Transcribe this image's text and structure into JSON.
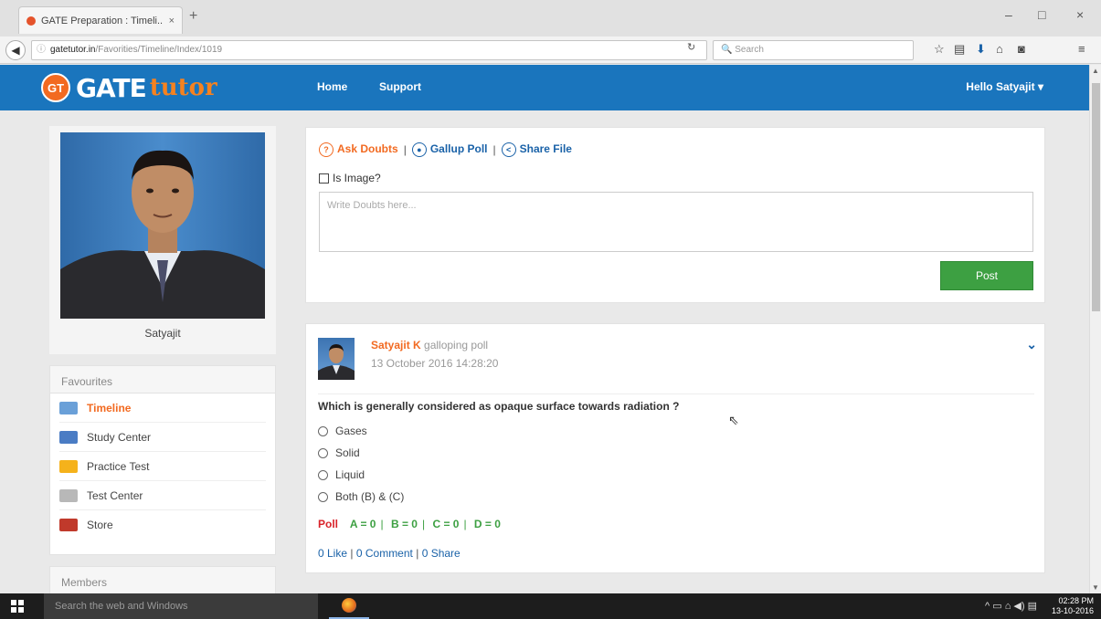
{
  "browser": {
    "tab_title": "GATE Preparation : Timeli...",
    "tab_close": "×",
    "new_tab": "+",
    "url_host": "gatetutor.in",
    "url_path": "/Favorities/Timeline/Index/1019",
    "search_placeholder": "Search",
    "window_controls": [
      "–",
      "□",
      "×"
    ]
  },
  "site": {
    "logo_badge": "GT",
    "logo_gate": "GATE",
    "logo_tutor": "tutor",
    "nav": [
      "Home",
      "Support"
    ],
    "user_greeting": "Hello Satyajit ▾"
  },
  "profile": {
    "name": "Satyajit"
  },
  "favourites": {
    "heading": "Favourites",
    "items": [
      {
        "label": "Timeline",
        "icon": "timeline-icon",
        "color": "#6aa0d8",
        "active": true
      },
      {
        "label": "Study Center",
        "icon": "books-icon",
        "color": "#4a7cc4",
        "active": false
      },
      {
        "label": "Practice Test",
        "icon": "clipboard-icon",
        "color": "#f5b21b",
        "active": false
      },
      {
        "label": "Test Center",
        "icon": "phone-icon",
        "color": "#b8b8b8",
        "active": false
      },
      {
        "label": "Store",
        "icon": "store-icon",
        "color": "#c0392b",
        "active": false
      }
    ]
  },
  "members": {
    "heading": "Members"
  },
  "composer": {
    "ask_doubts": "Ask Doubts",
    "gallup_poll": "Gallup Poll",
    "share_file": "Share File",
    "separator": "|",
    "is_image": "Is Image?",
    "placeholder": "Write Doubts here...",
    "post_label": "Post"
  },
  "post": {
    "author": "Satyajit K",
    "action": "galloping poll",
    "timestamp": "13 October 2016 14:28:20",
    "question": "Which is generally considered as opaque surface towards radiation ?",
    "options": [
      "Gases",
      "Solid",
      "Liquid",
      "Both (B) & (C)"
    ],
    "poll_label": "Poll",
    "poll_results": [
      "A = 0",
      "B = 0",
      "C = 0",
      "D = 0"
    ],
    "likes": "0 Like",
    "comments": "0 Comment",
    "shares": "0 Share"
  },
  "taskbar": {
    "search_placeholder": "Search the web and Windows",
    "time": "02:28 PM",
    "date": "13-10-2016"
  },
  "colors": {
    "header_blue": "#1a75bd",
    "brand_orange": "#f26a21",
    "post_green": "#3da042",
    "poll_red": "#d9232a"
  }
}
